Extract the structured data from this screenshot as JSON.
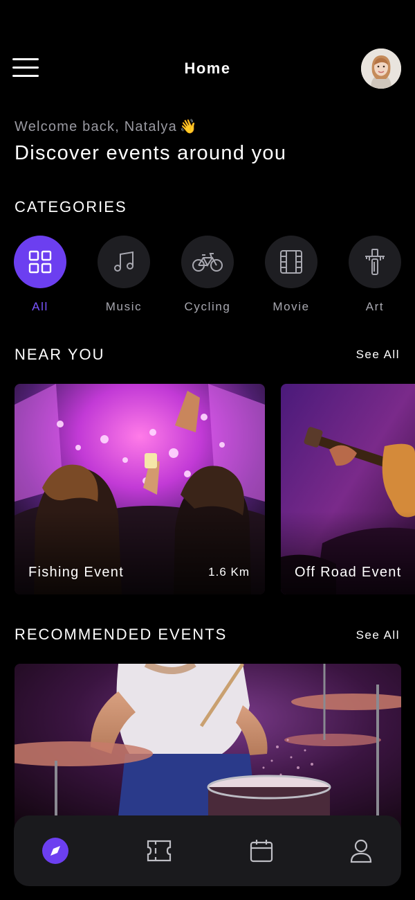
{
  "header": {
    "title": "Home",
    "menu_icon": "hamburger-menu-icon",
    "avatar_icon": "user-avatar"
  },
  "greeting": {
    "welcome": "Welcome back, Natalya",
    "wave_emoji": "👋",
    "headline": "Discover events around you"
  },
  "categories": {
    "title": "CATEGORIES",
    "items": [
      {
        "label": "All",
        "icon": "grid-icon",
        "active": true
      },
      {
        "label": "Music",
        "icon": "music-note-icon",
        "active": false
      },
      {
        "label": "Cycling",
        "icon": "bicycle-icon",
        "active": false
      },
      {
        "label": "Movie",
        "icon": "film-icon",
        "active": false
      },
      {
        "label": "Art",
        "icon": "paint-tool-icon",
        "active": false
      }
    ]
  },
  "near_you": {
    "title": "NEAR YOU",
    "see_all": "See All",
    "cards": [
      {
        "title": "Fishing Event",
        "distance": "1.6 Km"
      },
      {
        "title": "Off Road Event",
        "distance": ""
      }
    ]
  },
  "recommended": {
    "title": "RECOMMENDED EVENTS",
    "see_all": "See All"
  },
  "bottom_nav": {
    "items": [
      {
        "name": "explore",
        "icon": "compass-icon",
        "active": true
      },
      {
        "name": "tickets",
        "icon": "ticket-icon",
        "active": false
      },
      {
        "name": "calendar",
        "icon": "calendar-icon",
        "active": false
      },
      {
        "name": "profile",
        "icon": "user-icon",
        "active": false
      }
    ]
  },
  "colors": {
    "background": "#000000",
    "accent": "#6c3ff0",
    "surface": "#1a1a1d",
    "muted_text": "#9a9aa2"
  }
}
